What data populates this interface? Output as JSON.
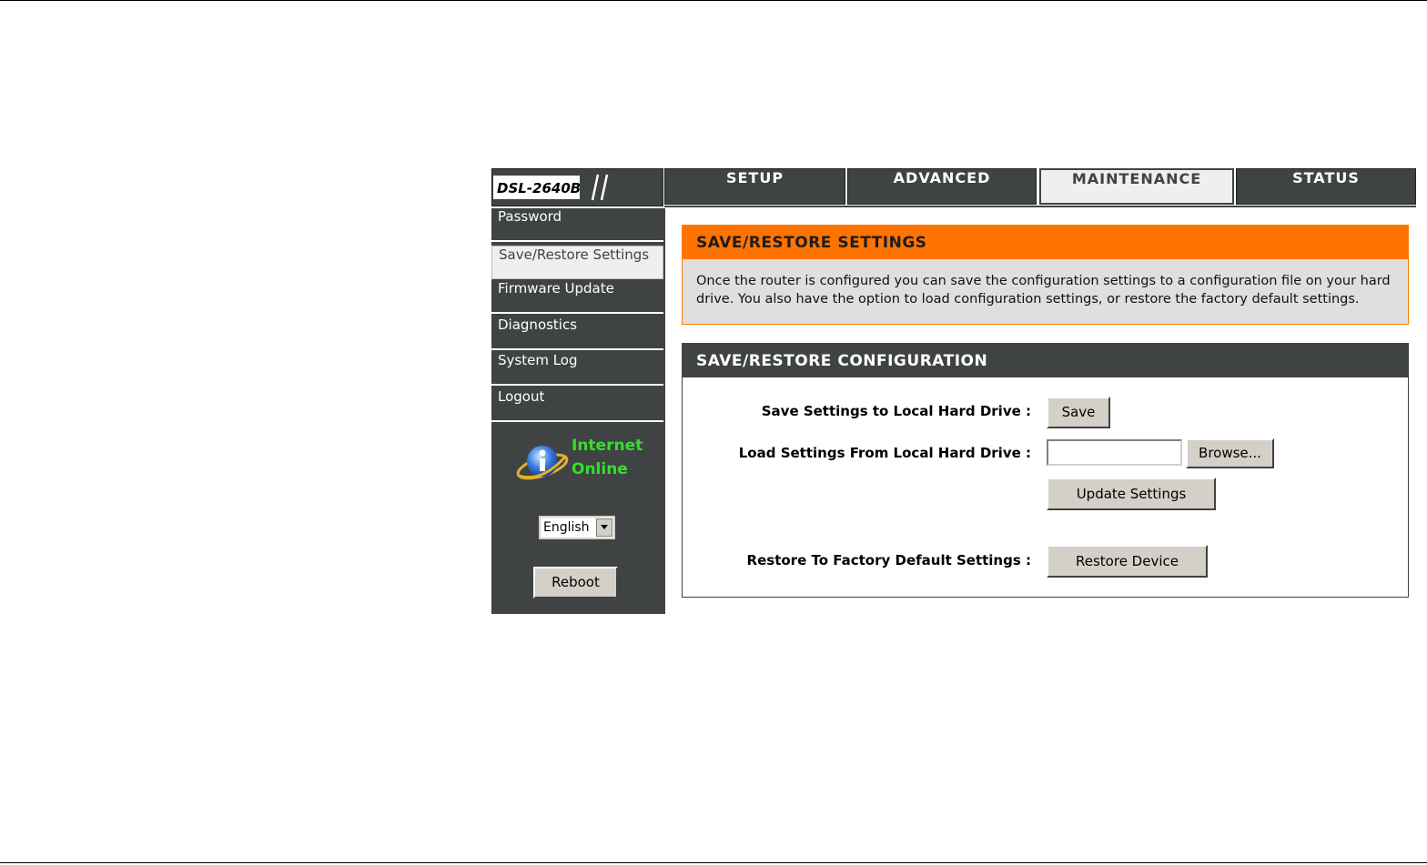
{
  "brand": {
    "model": "DSL-2640B"
  },
  "nav": {
    "tabs": [
      {
        "label": "SETUP"
      },
      {
        "label": "ADVANCED"
      },
      {
        "label": "MAINTENANCE"
      },
      {
        "label": "STATUS"
      }
    ],
    "active": "MAINTENANCE"
  },
  "sidebar": {
    "items": [
      {
        "label": "Password"
      },
      {
        "label": "Save/Restore Settings"
      },
      {
        "label": "Firmware Update"
      },
      {
        "label": "Diagnostics"
      },
      {
        "label": "System Log"
      },
      {
        "label": "Logout"
      }
    ],
    "active": "Save/Restore Settings",
    "status": {
      "line1": "Internet",
      "line2": "Online",
      "color": "#33e02b"
    },
    "language": {
      "selected": "English"
    },
    "reboot_label": "Reboot"
  },
  "info_panel": {
    "title": "SAVE/RESTORE SETTINGS",
    "description": "Once the router is configured you can save the configuration settings to a configuration file on your hard drive. You also have the option to load configuration settings, or restore the factory default settings."
  },
  "config_panel": {
    "title": "SAVE/RESTORE CONFIGURATION",
    "save_label": "Save Settings to Local Hard Drive :",
    "save_button": "Save",
    "load_label": "Load Settings From Local Hard Drive :",
    "file_value": "",
    "browse_button": "Browse...",
    "update_button": "Update Settings",
    "restore_label": "Restore To Factory Default Settings :",
    "restore_button": "Restore Device"
  },
  "colors": {
    "dark_gray": "#404343",
    "orange": "#ff7400",
    "status_green": "#33e02b"
  }
}
